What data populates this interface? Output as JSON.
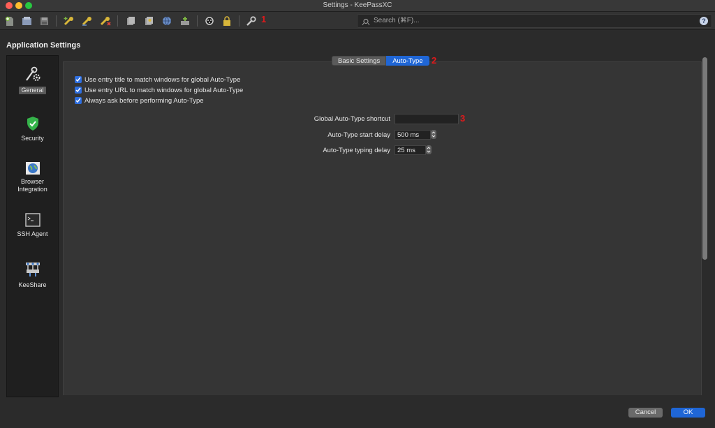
{
  "window": {
    "title": "Settings - KeePassXC"
  },
  "toolbar": {
    "buttons": [
      {
        "name": "new-database-icon",
        "color": "#9fbf7a"
      },
      {
        "name": "open-database-icon",
        "color": "#8a9ab8"
      },
      {
        "name": "save-database-icon",
        "color": "#8a8a8a"
      },
      {
        "name": "add-entry-icon",
        "color": "#d8b63a"
      },
      {
        "name": "edit-entry-icon",
        "color": "#d8b63a"
      },
      {
        "name": "delete-entry-icon",
        "color": "#d8b63a"
      },
      {
        "name": "copy-username-icon",
        "color": "#a8a8a8"
      },
      {
        "name": "copy-password-icon",
        "color": "#a8a8a8"
      },
      {
        "name": "copy-url-icon",
        "color": "#6a8ec8"
      },
      {
        "name": "autotype-icon",
        "color": "#8fb07a"
      },
      {
        "name": "password-generator-icon",
        "color": "#d0d0d0"
      },
      {
        "name": "lock-database-icon",
        "color": "#d8b63a"
      },
      {
        "name": "settings-icon",
        "color": "#c8c8c8"
      }
    ],
    "annotation_1": "1"
  },
  "search": {
    "placeholder": "Search (⌘F)...",
    "help": "?"
  },
  "heading": "Application Settings",
  "sidebar": {
    "items": [
      {
        "label": "General",
        "icon": "gear-wrench-icon",
        "selected": true
      },
      {
        "label": "Security",
        "icon": "shield-icon",
        "selected": false
      },
      {
        "label": "Browser\nIntegration",
        "icon": "globe-icon",
        "selected": false
      },
      {
        "label": "SSH Agent",
        "icon": "terminal-icon",
        "selected": false
      },
      {
        "label": "KeeShare",
        "icon": "network-icon",
        "selected": false
      }
    ]
  },
  "tabs": {
    "basic": "Basic Settings",
    "autotype": "Auto-Type",
    "annotation_2": "2"
  },
  "autotype": {
    "checks": [
      {
        "label": "Use entry title to match windows for global Auto-Type",
        "checked": true
      },
      {
        "label": "Use entry URL to match windows for global Auto-Type",
        "checked": true
      },
      {
        "label": "Always ask before performing Auto-Type",
        "checked": true
      }
    ],
    "shortcut_label": "Global Auto-Type shortcut",
    "shortcut_value": "",
    "annotation_3": "3",
    "start_delay_label": "Auto-Type start delay",
    "start_delay_value": "500 ms",
    "typing_delay_label": "Auto-Type typing delay",
    "typing_delay_value": "25 ms"
  },
  "footer": {
    "cancel": "Cancel",
    "ok": "OK"
  },
  "colors": {
    "accent": "#1f66d6",
    "annotation": "#e0191b"
  }
}
